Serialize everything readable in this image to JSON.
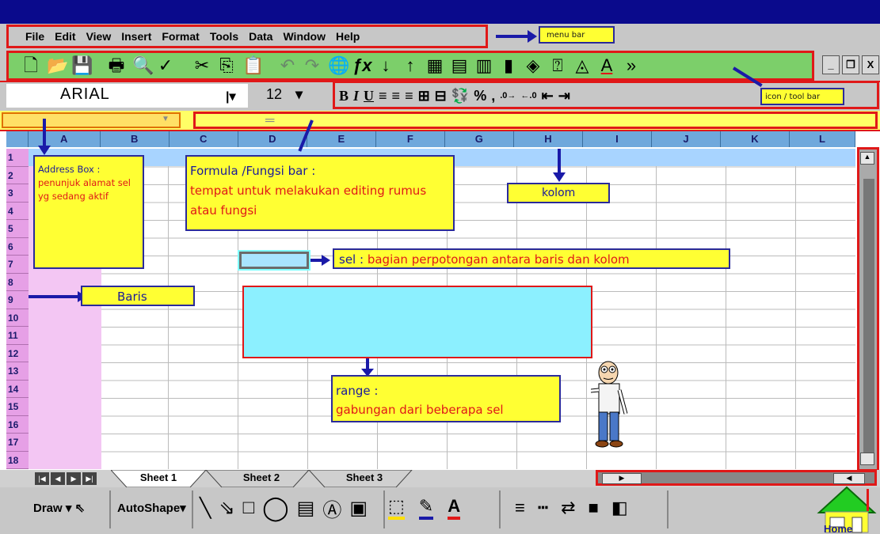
{
  "menu": {
    "items": [
      "File",
      "Edit",
      "View",
      "Insert",
      "Format",
      "Tools",
      "Data",
      "Window",
      "Help"
    ]
  },
  "toolbar": {
    "font_name": "ARIAL",
    "font_size": "12",
    "format_labels": [
      "B",
      "I",
      "U"
    ],
    "percent": "%"
  },
  "columns": [
    "A",
    "B",
    "C",
    "D",
    "E",
    "F",
    "G",
    "H",
    "I",
    "J",
    "K",
    "L"
  ],
  "rows": [
    "1",
    "2",
    "3",
    "4",
    "5",
    "6",
    "7",
    "8",
    "9",
    "10",
    "11",
    "12",
    "13",
    "14",
    "15",
    "16",
    "17",
    "18"
  ],
  "sheets": [
    "Sheet 1",
    "Sheet 2",
    "Sheet 3"
  ],
  "drawbar": {
    "draw_label": "Draw",
    "autoshape_label": "AutoShape"
  },
  "annotations": {
    "menu_bar": "menu bar",
    "icon_tool_bar": "icon / tool bar",
    "address_box_title": "Address Box :",
    "address_box_body": "penunjuk alamat sel yg sedang aktif",
    "formula_title": "Formula /Fungsi bar :",
    "formula_body": "tempat untuk melakukan editing rumus atau fungsi",
    "kolom": "kolom",
    "sel_title": "sel :",
    "sel_body": "bagian perpotongan antara baris dan kolom",
    "baris": "Baris",
    "range_title": "range :",
    "range_body": "gabungan dari beberapa sel",
    "home": "Home"
  },
  "colors": {
    "title_bar": "#0a0a8c",
    "toolbar_green": "#7ccf6a",
    "outline_red": "#e01818",
    "note_yellow": "#ffff33",
    "column_header_blue": "#6fa8dc",
    "row_header_pink": "#e6a0e6",
    "range_cyan": "#8cf0ff"
  }
}
